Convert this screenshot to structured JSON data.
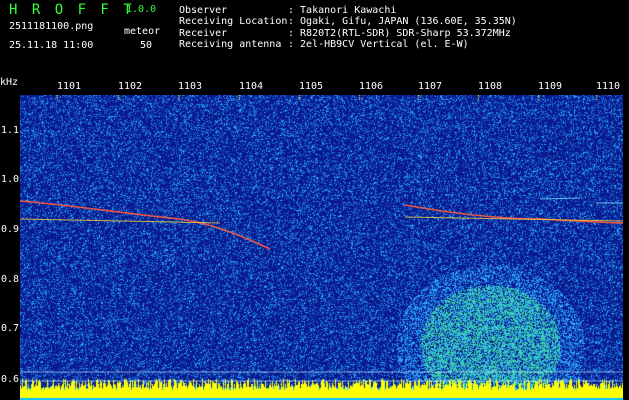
{
  "app": {
    "name": "H R O F F T",
    "version": "1.0.0"
  },
  "file": {
    "name": "2511181100.png",
    "datetime": "25.11.18 11:00"
  },
  "detection": {
    "label": "meteor",
    "count": "50"
  },
  "station": {
    "rows": [
      {
        "label": "Observer",
        "value": ": Takanori Kawachi"
      },
      {
        "label": "Receiving Location",
        "value": ": Ogaki, Gifu, JAPAN (136.60E, 35.35N)"
      },
      {
        "label": "Receiver",
        "value": ": R820T2(RTL-SDR) SDR-Sharp 53.372MHz"
      },
      {
        "label": "Receiving antenna",
        "value": ": 2el-HB9CV Vertical (el. E-W)"
      }
    ]
  },
  "spectrogram": {
    "y_unit": "kHz",
    "x_ticks": [
      "1101",
      "1102",
      "1103",
      "1104",
      "1105",
      "1106",
      "1107",
      "1108",
      "1109",
      "1110"
    ],
    "y_ticks": [
      "1.1",
      "1.0",
      "0.9",
      "0.8",
      "0.7",
      "0.6"
    ],
    "colors": {
      "background": "#0a1a8c",
      "noise": "#4bb4ff",
      "signal": "#ff3b3b",
      "baseline": "#ffff00",
      "ticks": "#ffff00"
    }
  }
}
